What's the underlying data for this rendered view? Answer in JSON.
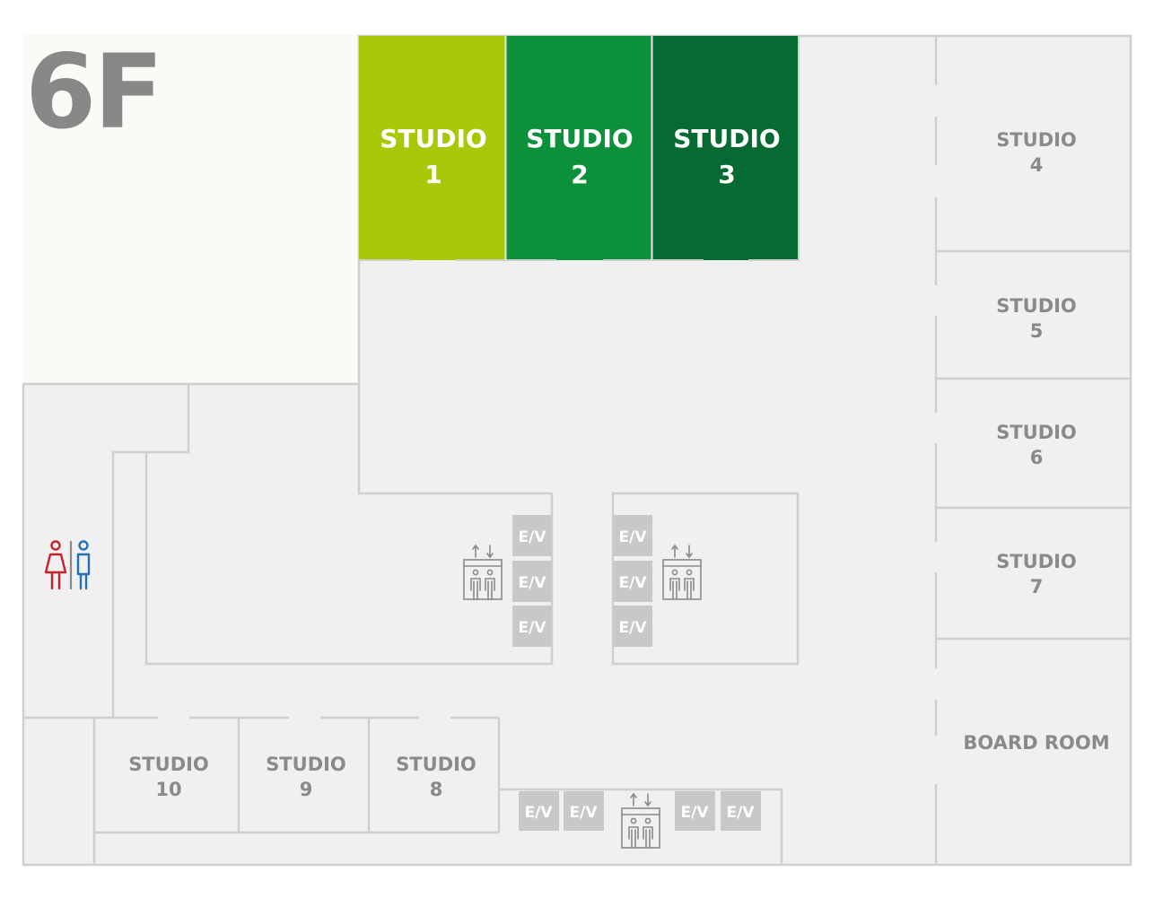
{
  "floor_label": "6F",
  "colors": {
    "plan_fill": "#f0f0f0",
    "open_area": "#fafaf6",
    "wall": "#cfcfcf",
    "room_label": "#8a8a8a",
    "elevator_tile": "#c8c8c8",
    "studio_1": "#a8c90a",
    "studio_2": "#0c913a",
    "studio_3": "#066a33",
    "female_icon": "#c8202a",
    "male_icon": "#1f72b8"
  },
  "highlighted_rooms": [
    {
      "id": "studio-1",
      "line1": "STUDIO",
      "line2": "1"
    },
    {
      "id": "studio-2",
      "line1": "STUDIO",
      "line2": "2"
    },
    {
      "id": "studio-3",
      "line1": "STUDIO",
      "line2": "3"
    }
  ],
  "rooms": [
    {
      "id": "studio-4",
      "line1": "STUDIO",
      "line2": "4"
    },
    {
      "id": "studio-5",
      "line1": "STUDIO",
      "line2": "5"
    },
    {
      "id": "studio-6",
      "line1": "STUDIO",
      "line2": "6"
    },
    {
      "id": "studio-7",
      "line1": "STUDIO",
      "line2": "7"
    },
    {
      "id": "board-room",
      "line1": "BOARD ROOM"
    },
    {
      "id": "studio-8",
      "line1": "STUDIO",
      "line2": "8"
    },
    {
      "id": "studio-9",
      "line1": "STUDIO",
      "line2": "9"
    },
    {
      "id": "studio-10",
      "line1": "STUDIO",
      "line2": "10"
    }
  ],
  "elevator_label": "E/V",
  "icons": {
    "restroom": "restroom-icon",
    "elevator": "elevator-icon"
  }
}
